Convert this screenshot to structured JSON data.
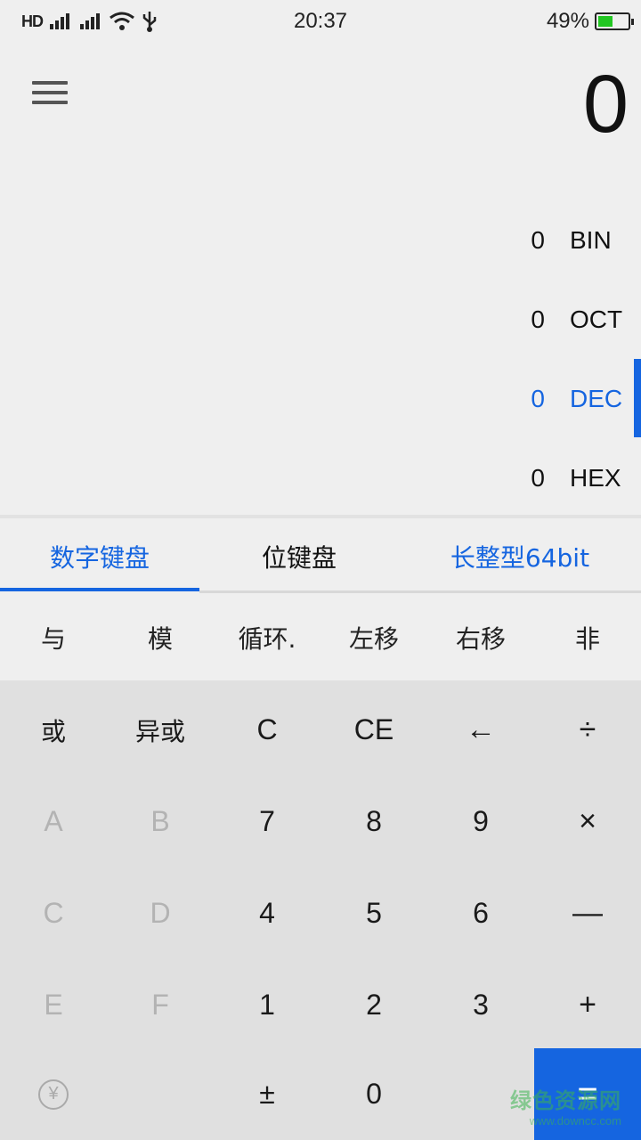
{
  "status_bar": {
    "network_label": "HD",
    "time": "20:37",
    "battery_percent_text": "49%",
    "battery_level": 0.49,
    "colors": {
      "battery_fill": "#22c622"
    }
  },
  "display": {
    "menu_icon": "hamburger-menu-icon",
    "value": "0",
    "bases": [
      {
        "value": "0",
        "label": "BIN"
      },
      {
        "value": "0",
        "label": "OCT"
      },
      {
        "value": "0",
        "label": "DEC",
        "active": true
      },
      {
        "value": "0",
        "label": "HEX"
      }
    ]
  },
  "tabs": {
    "numeric": "数字键盘",
    "bit": "位键盘",
    "type": "长整型64bit"
  },
  "bit_ops": [
    "与",
    "模",
    "循环.",
    "左移",
    "右移",
    "非"
  ],
  "keys": {
    "row1": [
      "或",
      "异或",
      "C",
      "CE",
      "←",
      "÷"
    ],
    "row2": [
      "A",
      "B",
      "7",
      "8",
      "9",
      "×"
    ],
    "row3": [
      "C",
      "D",
      "4",
      "5",
      "6",
      "—"
    ],
    "row4": [
      "E",
      "F",
      "1",
      "2",
      "3",
      "+"
    ],
    "row5": [
      "¥",
      "",
      "±",
      "0",
      "",
      "="
    ]
  },
  "watermark": {
    "main": "绿色资源网",
    "sub": "www.downcc.com"
  },
  "colors": {
    "accent": "#1565e0",
    "background": "#efefef",
    "keypad": "#e0e0e0",
    "disabled_key": "#b3b3b3"
  }
}
